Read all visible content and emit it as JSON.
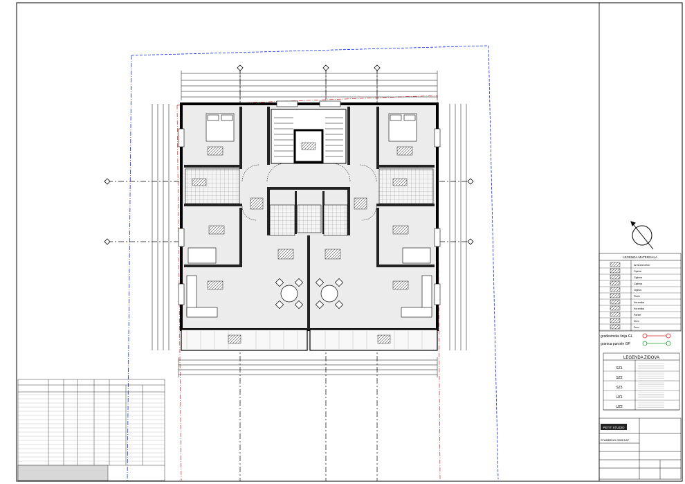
{
  "legend_materials": {
    "title": "LEGENDA MATERIJALA",
    "items": [
      {
        "label": "Armirani beton"
      },
      {
        "label": "Opeka"
      },
      {
        "label": "Ciglena"
      },
      {
        "label": "Ciglena"
      },
      {
        "label": "Opeka"
      },
      {
        "label": "Ploče"
      },
      {
        "label": "Keramika"
      },
      {
        "label": "Keramika"
      },
      {
        "label": "Parket"
      },
      {
        "label": "Drvo"
      },
      {
        "label": "Drvo"
      }
    ],
    "gl_label": "građevinska linija GL",
    "gp_label": "granica parcele GP"
  },
  "legend_walls": {
    "title": "LEGENDA ZIDOVA",
    "items": [
      {
        "code": "SZ1"
      },
      {
        "code": "SZ2"
      },
      {
        "code": "SZ3"
      },
      {
        "code": "UZ1"
      },
      {
        "code": "UZ2"
      }
    ]
  },
  "title_block": {
    "logo": "PETIT STUDIO",
    "project": "STAMBENO OBJEKAT"
  },
  "colors": {
    "line": "#000000",
    "gl_line": "#0a2bd6",
    "gp_line": "#d61b1b",
    "hatch": "#555555",
    "floor": "#ececec"
  }
}
